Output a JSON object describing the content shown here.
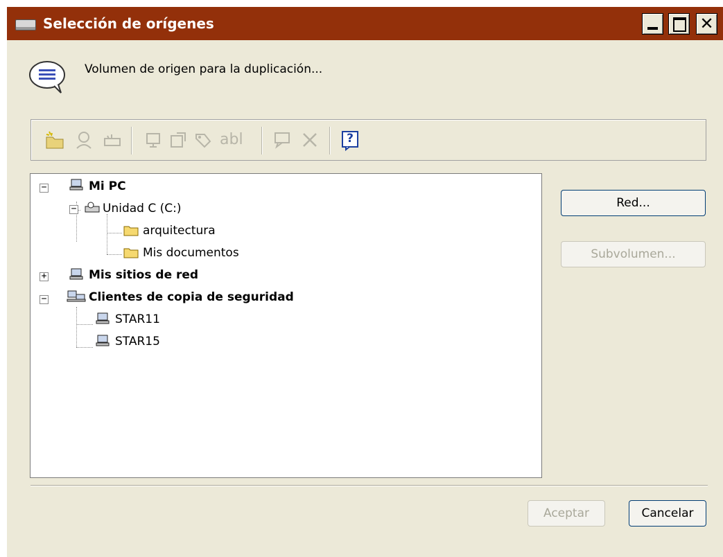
{
  "window": {
    "title": "Selección de orígenes",
    "controls": {
      "close": "✕"
    }
  },
  "heading": "Volumen de origen para la duplicación...",
  "toolbar": {
    "text_tool": "abl",
    "help": "?"
  },
  "tree": {
    "mi_pc": "Mi PC",
    "unidad_c": "Unidad C (C:)",
    "arquitectura": "arquitectura",
    "mis_documentos": "Mis documentos",
    "mis_sitios": "Mis sitios de red",
    "clientes": "Clientes de copia de seguridad",
    "star11": "STAR11",
    "star15": "STAR15",
    "collapse": "−",
    "expand": "+"
  },
  "buttons": {
    "red": "Red...",
    "subvolumen": "Subvolumen...",
    "aceptar": "Aceptar",
    "cancelar": "Cancelar"
  },
  "colors": {
    "titlebar": "#93300a",
    "dialog": "#ece9d8"
  }
}
